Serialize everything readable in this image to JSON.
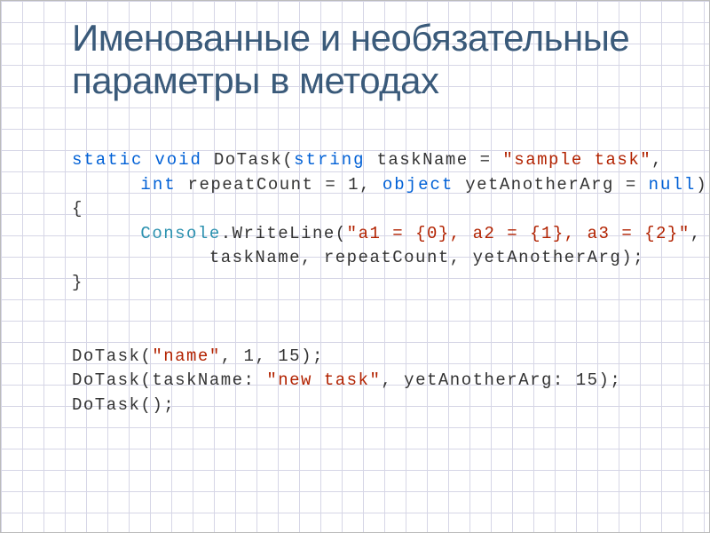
{
  "title": "Именованные и необязательные параметры в методах",
  "code": {
    "kw_static": "static",
    "kw_void": "void",
    "fn_name": " DoTask(",
    "type_string": "string",
    "p1": " taskName = ",
    "str_sample": "\"sample task\"",
    "comma1": ",",
    "type_int": "int",
    "p2": " repeatCount = 1, ",
    "type_object": "object",
    "p3": " yetAnotherArg = ",
    "kw_null": "null",
    "paren_close": ")",
    "brace_open": "{",
    "cls_console": "Console",
    "writeline": ".WriteLine(",
    "str_format": "\"a1 = {0}, a2 = {1}, a3 = {2}\"",
    "writeline_tail": ",",
    "args_line": "taskName, repeatCount, yetAnotherArg);",
    "brace_close": "}",
    "call1_a": "DoTask(",
    "call1_str": "\"name\"",
    "call1_b": ", 1, 15);",
    "call2_a": "DoTask(taskName: ",
    "call2_str": "\"new task\"",
    "call2_b": ", yetAnotherArg: 15);",
    "call3": "DoTask();"
  }
}
